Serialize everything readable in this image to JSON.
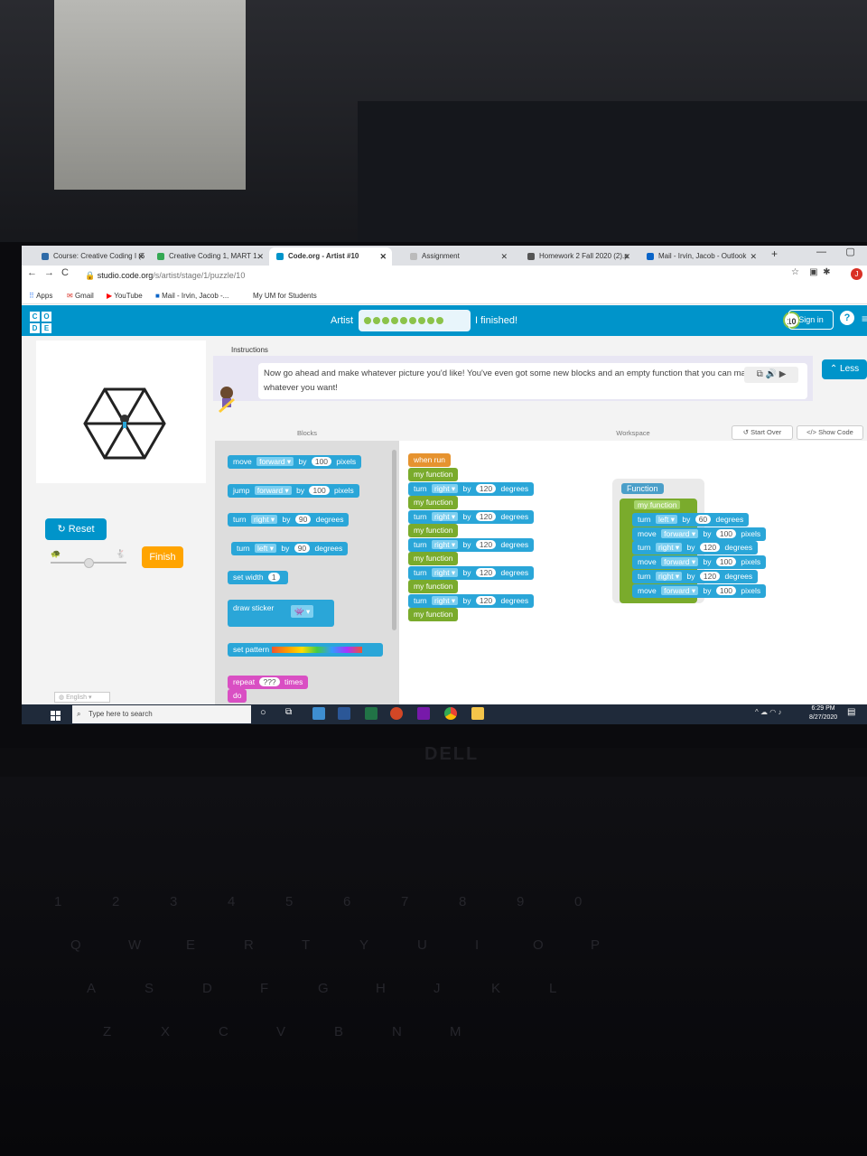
{
  "browser": {
    "tabs": [
      {
        "label": "Course: Creative Coding I (5",
        "color": "#2f6ba8"
      },
      {
        "label": "Creative Coding 1, MART 1.",
        "color": "#34a853"
      },
      {
        "label": "Code.org - Artist #10",
        "color": "#0094ca"
      },
      {
        "label": "Assignment",
        "color": "#888888"
      },
      {
        "label": "Homework 2 Fall 2020 (2).p",
        "color": "#555555"
      },
      {
        "label": "Mail - Irvin, Jacob - Outlook",
        "color": "#0a64c8"
      }
    ],
    "new_tab": "+",
    "url_host": "studio.code.org",
    "url_path": "/s/artist/stage/1/puzzle/10",
    "avatar_letter": "J",
    "bookmarks": [
      "Apps",
      "Gmail",
      "YouTube",
      "Mail - Irvin, Jacob -...",
      "My UM for Students"
    ]
  },
  "header": {
    "logo": [
      "C",
      "O",
      "D",
      "E"
    ],
    "puzzle_name": "Artist",
    "current_level": "10",
    "completed_dots": 9,
    "finished_label": "I finished!",
    "signin_label": "Sign in",
    "help_label": "?"
  },
  "stage": {
    "reset_label": "Reset",
    "finish_label": "Finish",
    "language": "English",
    "speed_fraction": 0.5
  },
  "instructions": {
    "tab_label": "Instructions",
    "text": "Now go ahead and make whatever picture you'd like! You've even got some new blocks and an empty function that you can make do whatever you want!",
    "less_label": "Less"
  },
  "blocks_panel": {
    "header": "Blocks",
    "blocks": [
      {
        "parts": [
          "move",
          "forward ▾",
          "by",
          "100",
          "pixels"
        ],
        "color": "blue"
      },
      {
        "parts": [
          "jump",
          "forward ▾",
          "by",
          "100",
          "pixels"
        ],
        "color": "blue"
      },
      {
        "parts": [
          "turn",
          "right ▾",
          "by",
          "90",
          "degrees"
        ],
        "color": "blue"
      },
      {
        "parts": [
          "turn",
          "left ▾",
          "by",
          "90",
          "degrees"
        ],
        "color": "blue"
      },
      {
        "parts": [
          "set width",
          "1"
        ],
        "color": "blue"
      },
      {
        "parts": [
          "draw sticker"
        ],
        "color": "blue"
      },
      {
        "parts": [
          "set pattern"
        ],
        "color": "blue"
      },
      {
        "parts": [
          "repeat",
          "???",
          "times"
        ],
        "color": "pink"
      },
      {
        "parts": [
          "do"
        ],
        "color": "pink"
      }
    ]
  },
  "workspace": {
    "header": "Workspace",
    "start_over_label": "Start Over",
    "show_code_label": "Show Code",
    "when_run": "when run",
    "program": [
      "my function",
      "turn|right ▾|by|120|degrees",
      "my function",
      "turn|right ▾|by|120|degrees",
      "my function",
      "turn|right ▾|by|120|degrees",
      "my function",
      "turn|right ▾|by|120|degrees",
      "my function",
      "turn|right ▾|by|120|degrees",
      "my function"
    ],
    "function_def": {
      "category": "Function",
      "name": "my function",
      "body": [
        "turn|left ▾|by|60|degrees",
        "move|forward ▾|by|100|pixels",
        "turn|right ▾|by|120|degrees",
        "move|forward ▾|by|100|pixels",
        "turn|right ▾|by|120|degrees",
        "move|forward ▾|by|100|pixels"
      ]
    }
  },
  "taskbar": {
    "search_placeholder": "Type here to search",
    "time": "6:29 PM",
    "date": "8/27/2020"
  },
  "laptop": {
    "brand": "DELL"
  },
  "colors": {
    "codeorg_blue": "#0094ca",
    "action_blue": "#2aa6d8",
    "function_green": "#7aab2c",
    "event_orange": "#e6932f",
    "loop_pink": "#d94fc3",
    "finish_orange": "#ffa400"
  }
}
